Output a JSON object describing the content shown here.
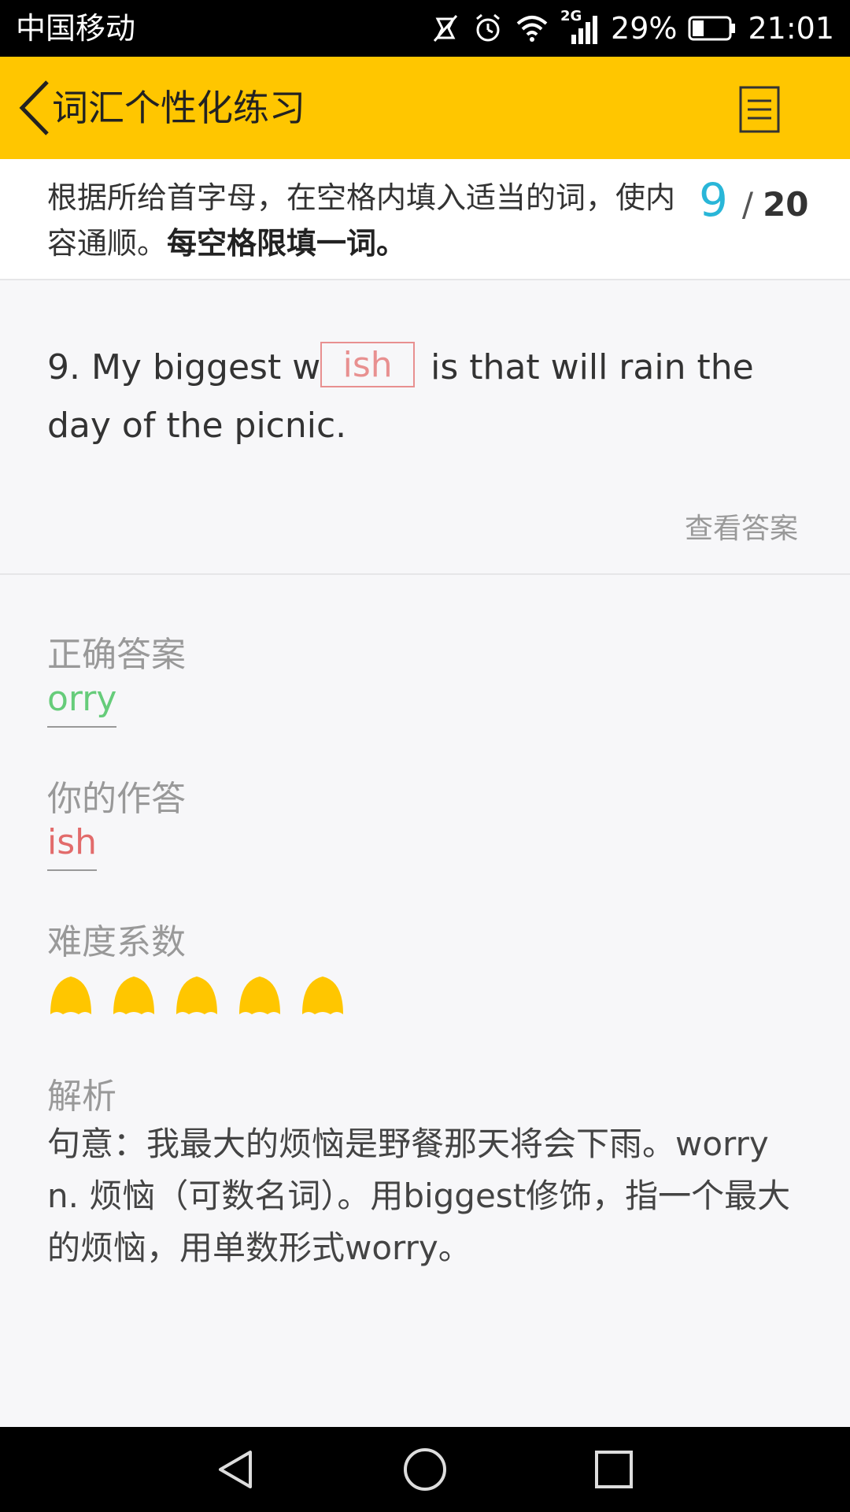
{
  "status_bar": {
    "carrier": "中国移动",
    "network": "2G",
    "battery": "29%",
    "time": "21:01"
  },
  "app_bar": {
    "title": "词汇个性化练习",
    "back_icon": "chevron-left-icon",
    "menu_icon": "list-menu-icon",
    "background": "#ffc600"
  },
  "instruction": {
    "text": "根据所给首字母，在空格内填入适当的词，使内容通顺。",
    "bold_text": "每空格限填一词。",
    "current": "9",
    "separator": "/",
    "total": "20"
  },
  "question": {
    "before": "9. My biggest w",
    "blank_answer": "ish",
    "after": " is that will rain the day of the picnic.",
    "view_answer_label": "查看答案"
  },
  "correct_answer": {
    "label": "正确答案",
    "value": "orry",
    "color": "#66cc7a"
  },
  "your_answer": {
    "label": "你的作答",
    "value": "ish",
    "color": "#e26b6b"
  },
  "difficulty": {
    "label": "难度系数",
    "level": 5,
    "max": 5,
    "color": "#ffc600"
  },
  "analysis": {
    "label": "解析",
    "text": "句意：我最大的烦恼是野餐那天将会下雨。worry n. 烦恼（可数名词）。用biggest修饰，指一个最大的烦恼，用单数形式worry。"
  },
  "nav_bar": {
    "back_icon": "triangle-back-icon",
    "home_icon": "circle-home-icon",
    "recents_icon": "square-recents-icon"
  }
}
